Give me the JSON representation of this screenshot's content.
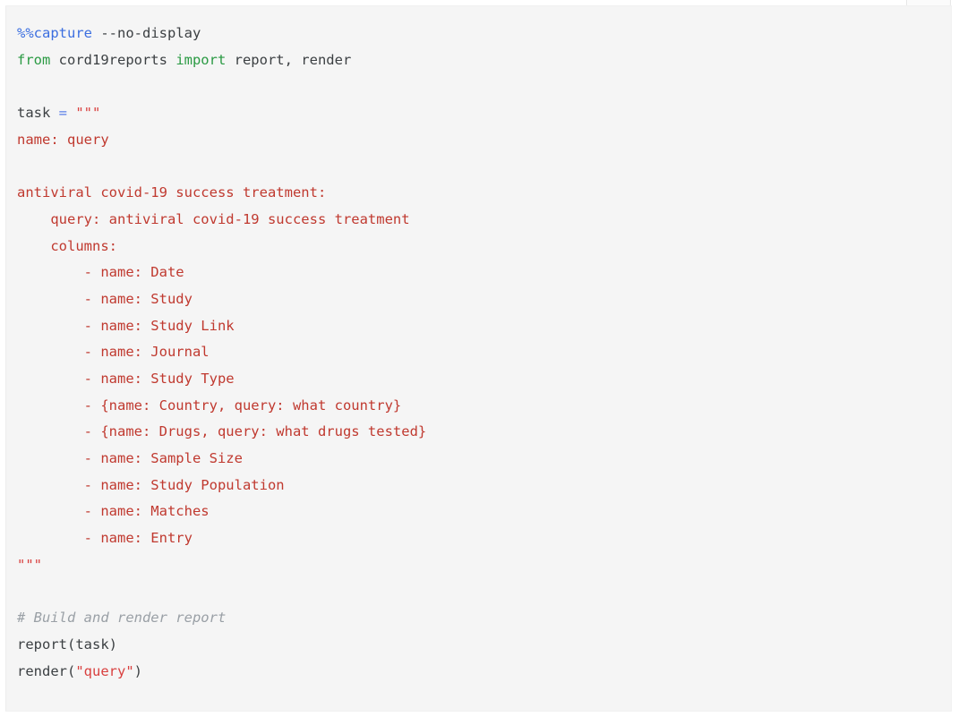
{
  "window": {
    "background_color": "#ffffff"
  },
  "toolbar": {
    "clipped_button_label": ""
  },
  "cell": {
    "name": "code-cell",
    "background_color": "#f5f5f5",
    "border_color": "#f0f0f0",
    "language": "python",
    "lines": [
      {
        "index": 0,
        "text": "%%capture --no-display",
        "tokens": [
          {
            "t": "%%capture",
            "c": "tok-magic"
          },
          {
            "t": " --no-display",
            "c": "tok-plain"
          }
        ]
      },
      {
        "index": 1,
        "text": "from cord19reports import report, render",
        "tokens": [
          {
            "t": "from",
            "c": "tok-keyword"
          },
          {
            "t": " cord19reports ",
            "c": "tok-plain"
          },
          {
            "t": "import",
            "c": "tok-keyword"
          },
          {
            "t": " report, render",
            "c": "tok-plain"
          }
        ]
      },
      {
        "index": 2,
        "text": "",
        "tokens": []
      },
      {
        "index": 3,
        "text": "task = \"\"\"",
        "tokens": [
          {
            "t": "task ",
            "c": "tok-plain"
          },
          {
            "t": "=",
            "c": "tok-operator"
          },
          {
            "t": " \"\"\"",
            "c": "tok-string"
          }
        ]
      },
      {
        "index": 4,
        "text": "name: query",
        "tokens": [
          {
            "t": "name: query",
            "c": "tok-yaml"
          }
        ]
      },
      {
        "index": 5,
        "text": "",
        "tokens": []
      },
      {
        "index": 6,
        "text": "antiviral covid-19 success treatment:",
        "tokens": [
          {
            "t": "antiviral covid-19 success treatment:",
            "c": "tok-yaml"
          }
        ]
      },
      {
        "index": 7,
        "text": "    query: antiviral covid-19 success treatment",
        "tokens": [
          {
            "t": "    query: antiviral covid-19 success treatment",
            "c": "tok-yaml"
          }
        ]
      },
      {
        "index": 8,
        "text": "    columns:",
        "tokens": [
          {
            "t": "    columns:",
            "c": "tok-yaml"
          }
        ]
      },
      {
        "index": 9,
        "text": "        - name: Date",
        "tokens": [
          {
            "t": "        - name: Date",
            "c": "tok-yaml"
          }
        ]
      },
      {
        "index": 10,
        "text": "        - name: Study",
        "tokens": [
          {
            "t": "        - name: Study",
            "c": "tok-yaml"
          }
        ]
      },
      {
        "index": 11,
        "text": "        - name: Study Link",
        "tokens": [
          {
            "t": "        - name: Study Link",
            "c": "tok-yaml"
          }
        ]
      },
      {
        "index": 12,
        "text": "        - name: Journal",
        "tokens": [
          {
            "t": "        - name: Journal",
            "c": "tok-yaml"
          }
        ]
      },
      {
        "index": 13,
        "text": "        - name: Study Type",
        "tokens": [
          {
            "t": "        - name: Study Type",
            "c": "tok-yaml"
          }
        ]
      },
      {
        "index": 14,
        "text": "        - {name: Country, query: what country}",
        "tokens": [
          {
            "t": "        - {name: Country, query: what country}",
            "c": "tok-yaml"
          }
        ]
      },
      {
        "index": 15,
        "text": "        - {name: Drugs, query: what drugs tested}",
        "tokens": [
          {
            "t": "        - {name: Drugs, query: what drugs tested}",
            "c": "tok-yaml"
          }
        ]
      },
      {
        "index": 16,
        "text": "        - name: Sample Size",
        "tokens": [
          {
            "t": "        - name: Sample Size",
            "c": "tok-yaml"
          }
        ]
      },
      {
        "index": 17,
        "text": "        - name: Study Population",
        "tokens": [
          {
            "t": "        - name: Study Population",
            "c": "tok-yaml"
          }
        ]
      },
      {
        "index": 18,
        "text": "        - name: Matches",
        "tokens": [
          {
            "t": "        - name: Matches",
            "c": "tok-yaml"
          }
        ]
      },
      {
        "index": 19,
        "text": "        - name: Entry",
        "tokens": [
          {
            "t": "        - name: Entry",
            "c": "tok-yaml"
          }
        ]
      },
      {
        "index": 20,
        "text": "\"\"\"",
        "tokens": [
          {
            "t": "\"\"\"",
            "c": "tok-string"
          }
        ]
      },
      {
        "index": 21,
        "text": "",
        "tokens": []
      },
      {
        "index": 22,
        "text": "# Build and render report",
        "tokens": [
          {
            "t": "# Build and render report",
            "c": "tok-comment"
          }
        ]
      },
      {
        "index": 23,
        "text": "report(task)",
        "tokens": [
          {
            "t": "report(task)",
            "c": "tok-plain"
          }
        ]
      },
      {
        "index": 24,
        "text": "render(\"query\")",
        "tokens": [
          {
            "t": "render(",
            "c": "tok-plain"
          },
          {
            "t": "\"query\"",
            "c": "tok-string"
          },
          {
            "t": ")",
            "c": "tok-plain"
          }
        ]
      }
    ]
  },
  "colors": {
    "magic": "#3c6fe0",
    "keyword": "#2a9a43",
    "operator": "#5a7fe8",
    "string": "#d9403f",
    "yaml_string": "#c0392f",
    "plain_text": "#3c4043",
    "comment": "#9aa0a6",
    "cell_background": "#f5f5f5",
    "page_background": "#ffffff"
  }
}
